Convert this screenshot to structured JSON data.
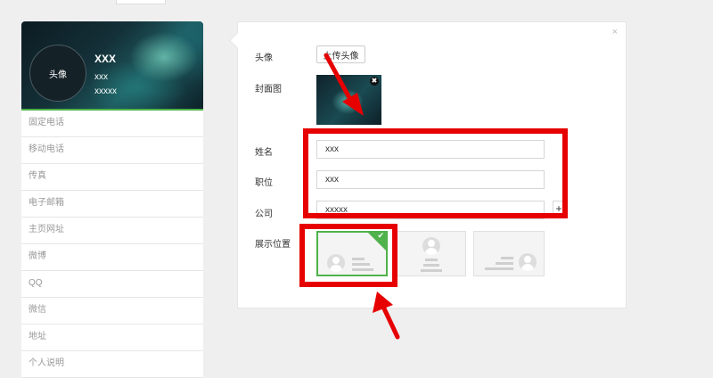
{
  "card": {
    "avatar_label": "头像",
    "name": "XXX",
    "title": "xxx",
    "company": "xxxxx",
    "fields": [
      {
        "key": "landline",
        "label": "固定电话"
      },
      {
        "key": "mobile",
        "label": "移动电话"
      },
      {
        "key": "fax",
        "label": "传真"
      },
      {
        "key": "email",
        "label": "电子邮箱"
      },
      {
        "key": "homepage",
        "label": "主页网址"
      },
      {
        "key": "weibo",
        "label": "微博"
      },
      {
        "key": "qq",
        "label": "QQ"
      },
      {
        "key": "wechat",
        "label": "微信"
      },
      {
        "key": "address",
        "label": "地址"
      },
      {
        "key": "bio",
        "label": "个人说明"
      }
    ]
  },
  "panel": {
    "close_glyph": "×",
    "avatar_label": "头像",
    "upload_button": "上传头像",
    "cover_label": "封面图",
    "cover_remove_glyph": "✖",
    "name_label": "姓名",
    "name_value": "xxx",
    "position_label": "职位",
    "position_value": "xxx",
    "company_label": "公司",
    "company_value": "xxxxx",
    "add_glyph": "+",
    "display_label": "展示位置",
    "display_options": [
      "avatar-left",
      "avatar-center",
      "avatar-right"
    ],
    "display_selected": "avatar-left",
    "check_glyph": "✔"
  },
  "icons": {
    "close": "close-icon",
    "cover_remove": "remove-cover-icon",
    "add": "plus-icon",
    "check": "check-icon",
    "placeholder": "avatar-placeholder-icon"
  },
  "colors": {
    "accent_green": "#4fb24a",
    "annotation_red": "#e60000",
    "background": "#efefef"
  }
}
